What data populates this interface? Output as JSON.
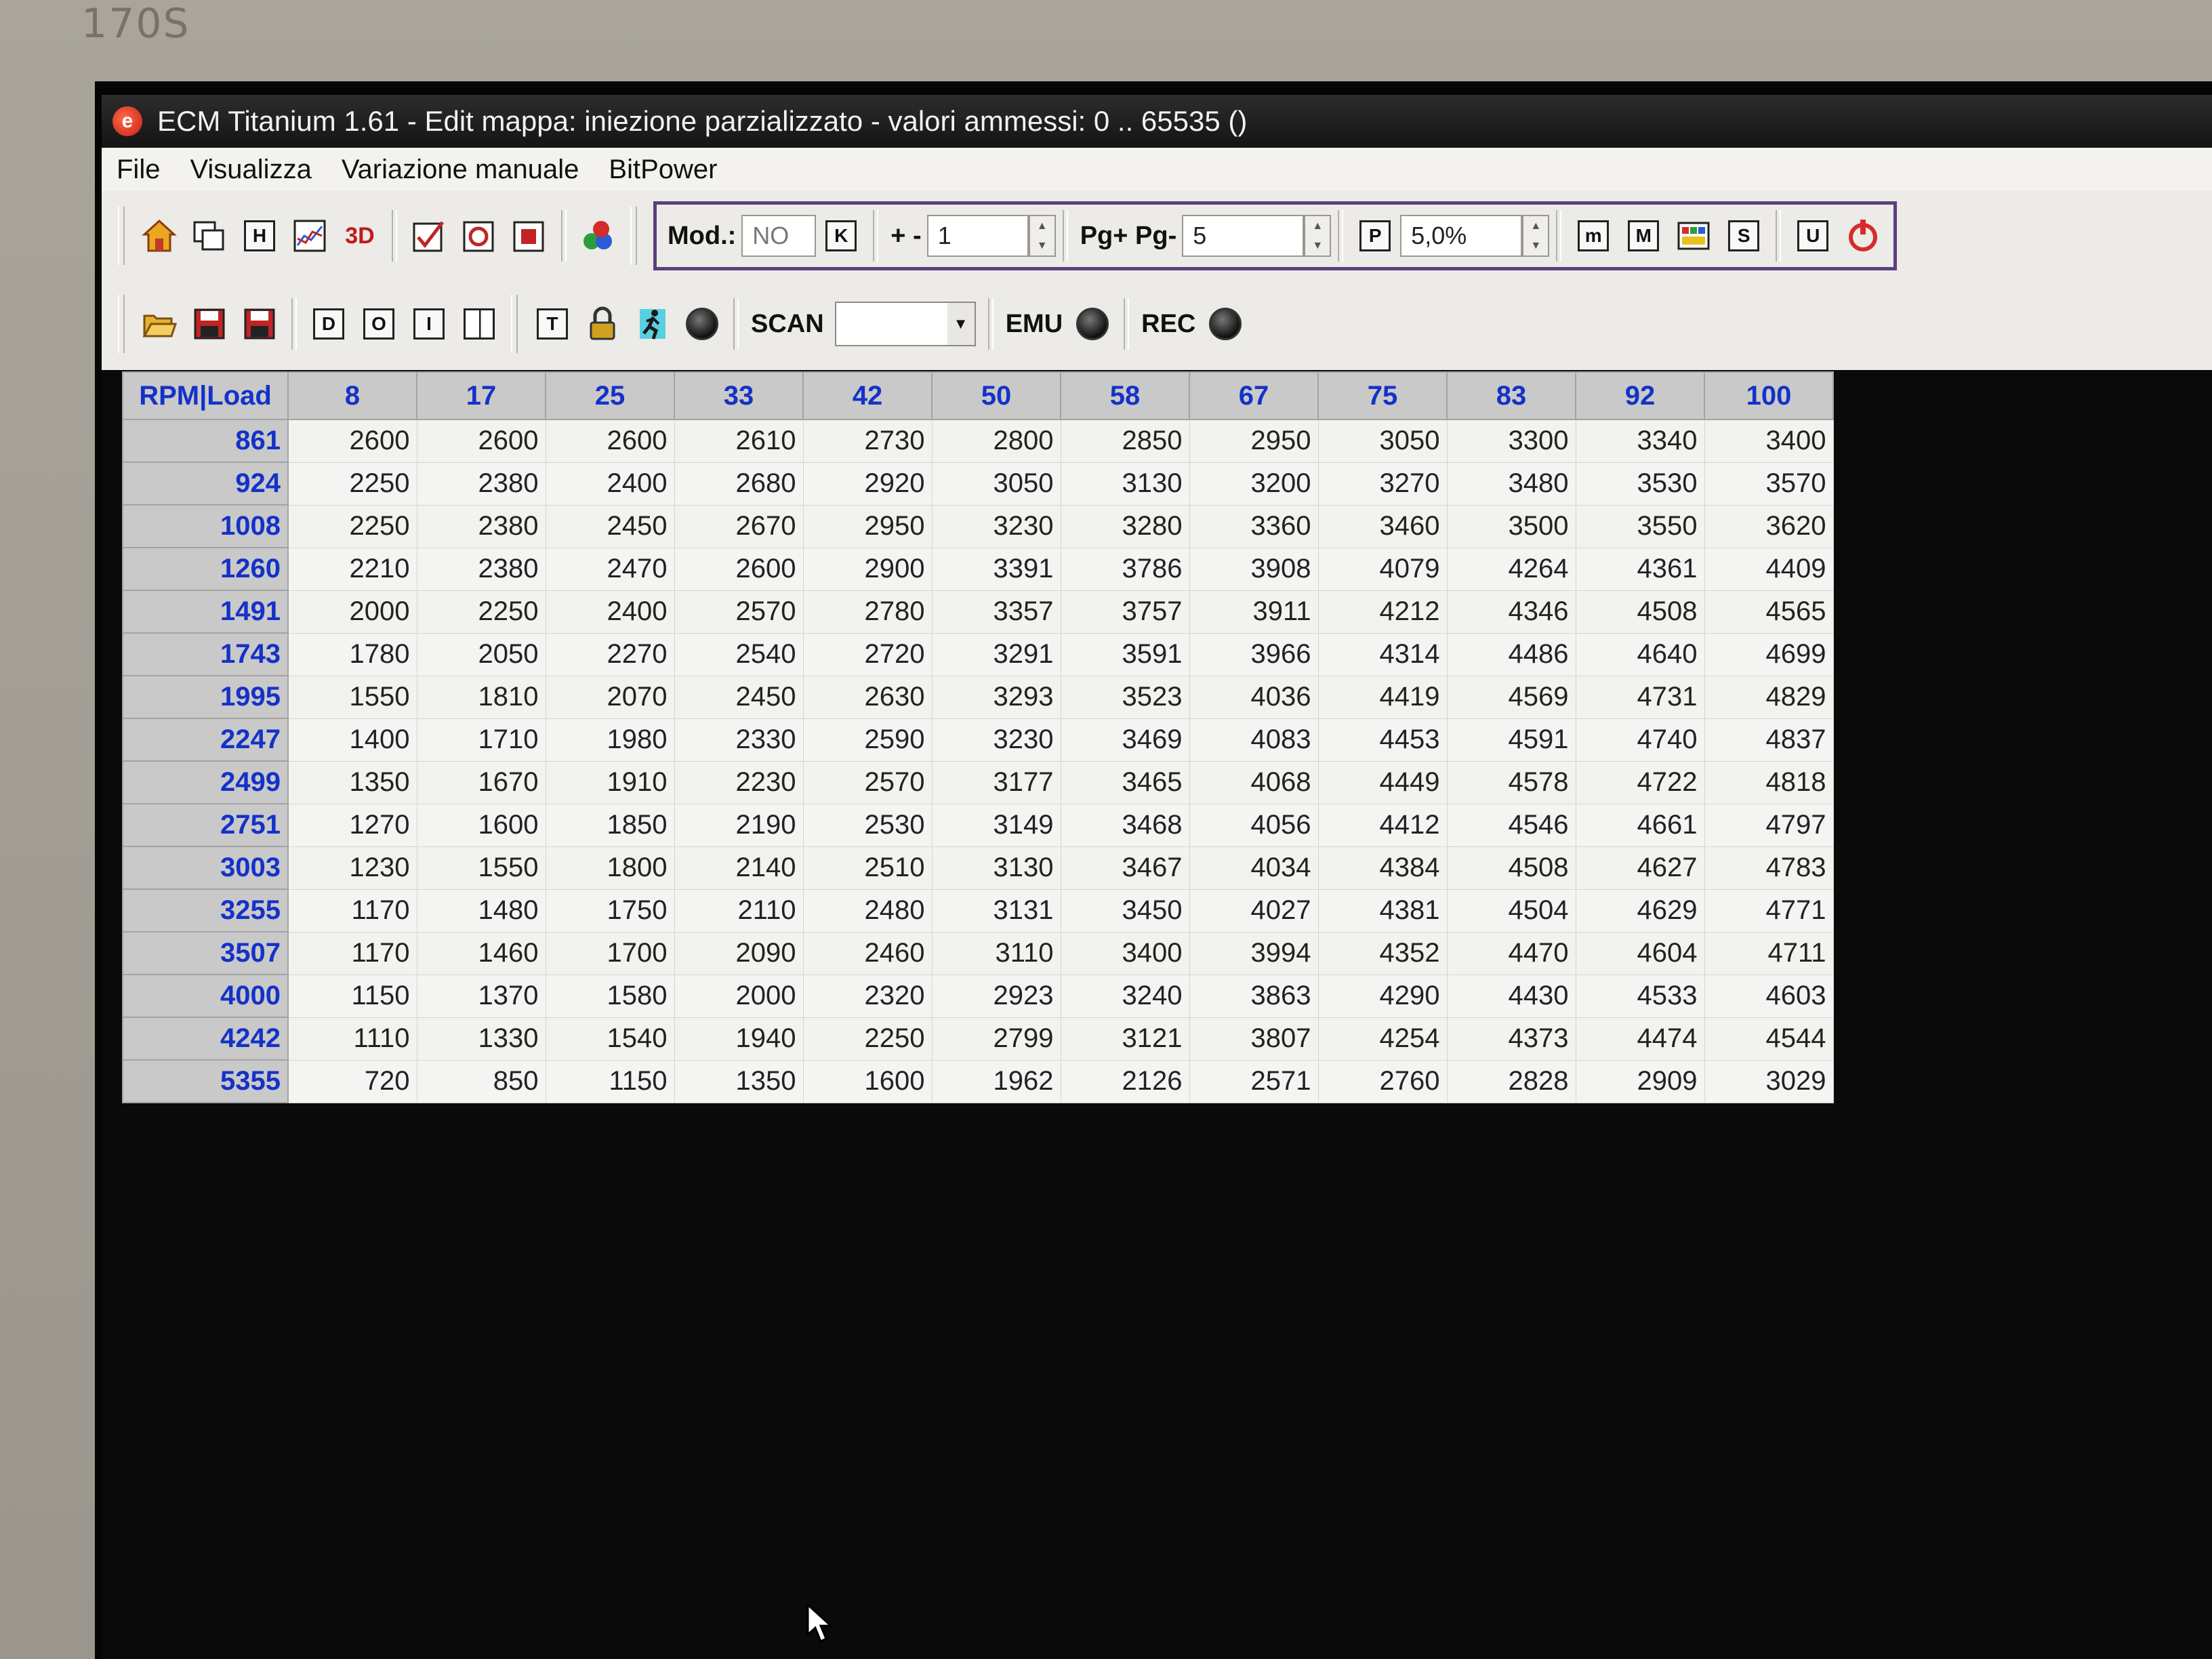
{
  "bezel_label": "170S",
  "window": {
    "title": "ECM Titanium 1.61 - Edit mappa: iniezione parzializzato - valori ammessi: 0 .. 65535 ()"
  },
  "menu": [
    "File",
    "Visualizza",
    "Variazione manuale",
    "BitPower"
  ],
  "toolbar": {
    "mod_label": "Mod.:",
    "mod_value": "NO",
    "k_button": "K",
    "plusminus_label": "+ -",
    "plusminus_value": "1",
    "pg_label": "Pg+ Pg-",
    "pg_value": "5",
    "p_button": "P",
    "percent_value": "5,0%",
    "scan_label": "SCAN",
    "emu_label": "EMU",
    "rec_label": "REC"
  },
  "table": {
    "corner": "RPM|Load",
    "load_headers": [
      "8",
      "17",
      "25",
      "33",
      "42",
      "50",
      "58",
      "67",
      "75",
      "83",
      "92",
      "100"
    ],
    "rows": [
      {
        "rpm": "861",
        "values": [
          "2600",
          "2600",
          "2600",
          "2610",
          "2730",
          "2800",
          "2850",
          "2950",
          "3050",
          "3300",
          "3340",
          "3400"
        ]
      },
      {
        "rpm": "924",
        "values": [
          "2250",
          "2380",
          "2400",
          "2680",
          "2920",
          "3050",
          "3130",
          "3200",
          "3270",
          "3480",
          "3530",
          "3570"
        ]
      },
      {
        "rpm": "1008",
        "values": [
          "2250",
          "2380",
          "2450",
          "2670",
          "2950",
          "3230",
          "3280",
          "3360",
          "3460",
          "3500",
          "3550",
          "3620"
        ]
      },
      {
        "rpm": "1260",
        "values": [
          "2210",
          "2380",
          "2470",
          "2600",
          "2900",
          "3391",
          "3786",
          "3908",
          "4079",
          "4264",
          "4361",
          "4409"
        ]
      },
      {
        "rpm": "1491",
        "values": [
          "2000",
          "2250",
          "2400",
          "2570",
          "2780",
          "3357",
          "3757",
          "3911",
          "4212",
          "4346",
          "4508",
          "4565"
        ]
      },
      {
        "rpm": "1743",
        "values": [
          "1780",
          "2050",
          "2270",
          "2540",
          "2720",
          "3291",
          "3591",
          "3966",
          "4314",
          "4486",
          "4640",
          "4699"
        ]
      },
      {
        "rpm": "1995",
        "values": [
          "1550",
          "1810",
          "2070",
          "2450",
          "2630",
          "3293",
          "3523",
          "4036",
          "4419",
          "4569",
          "4731",
          "4829"
        ]
      },
      {
        "rpm": "2247",
        "values": [
          "1400",
          "1710",
          "1980",
          "2330",
          "2590",
          "3230",
          "3469",
          "4083",
          "4453",
          "4591",
          "4740",
          "4837"
        ]
      },
      {
        "rpm": "2499",
        "values": [
          "1350",
          "1670",
          "1910",
          "2230",
          "2570",
          "3177",
          "3465",
          "4068",
          "4449",
          "4578",
          "4722",
          "4818"
        ]
      },
      {
        "rpm": "2751",
        "values": [
          "1270",
          "1600",
          "1850",
          "2190",
          "2530",
          "3149",
          "3468",
          "4056",
          "4412",
          "4546",
          "4661",
          "4797"
        ]
      },
      {
        "rpm": "3003",
        "values": [
          "1230",
          "1550",
          "1800",
          "2140",
          "2510",
          "3130",
          "3467",
          "4034",
          "4384",
          "4508",
          "4627",
          "4783"
        ]
      },
      {
        "rpm": "3255",
        "values": [
          "1170",
          "1480",
          "1750",
          "2110",
          "2480",
          "3131",
          "3450",
          "4027",
          "4381",
          "4504",
          "4629",
          "4771"
        ]
      },
      {
        "rpm": "3507",
        "values": [
          "1170",
          "1460",
          "1700",
          "2090",
          "2460",
          "3110",
          "3400",
          "3994",
          "4352",
          "4470",
          "4604",
          "4711"
        ]
      },
      {
        "rpm": "4000",
        "values": [
          "1150",
          "1370",
          "1580",
          "2000",
          "2320",
          "2923",
          "3240",
          "3863",
          "4290",
          "4430",
          "4533",
          "4603"
        ]
      },
      {
        "rpm": "4242",
        "values": [
          "1110",
          "1330",
          "1540",
          "1940",
          "2250",
          "2799",
          "3121",
          "3807",
          "4254",
          "4373",
          "4474",
          "4544"
        ]
      },
      {
        "rpm": "5355",
        "values": [
          "720",
          "850",
          "1150",
          "1350",
          "1600",
          "1962",
          "2126",
          "2571",
          "2760",
          "2828",
          "2909",
          "3029"
        ]
      }
    ]
  }
}
